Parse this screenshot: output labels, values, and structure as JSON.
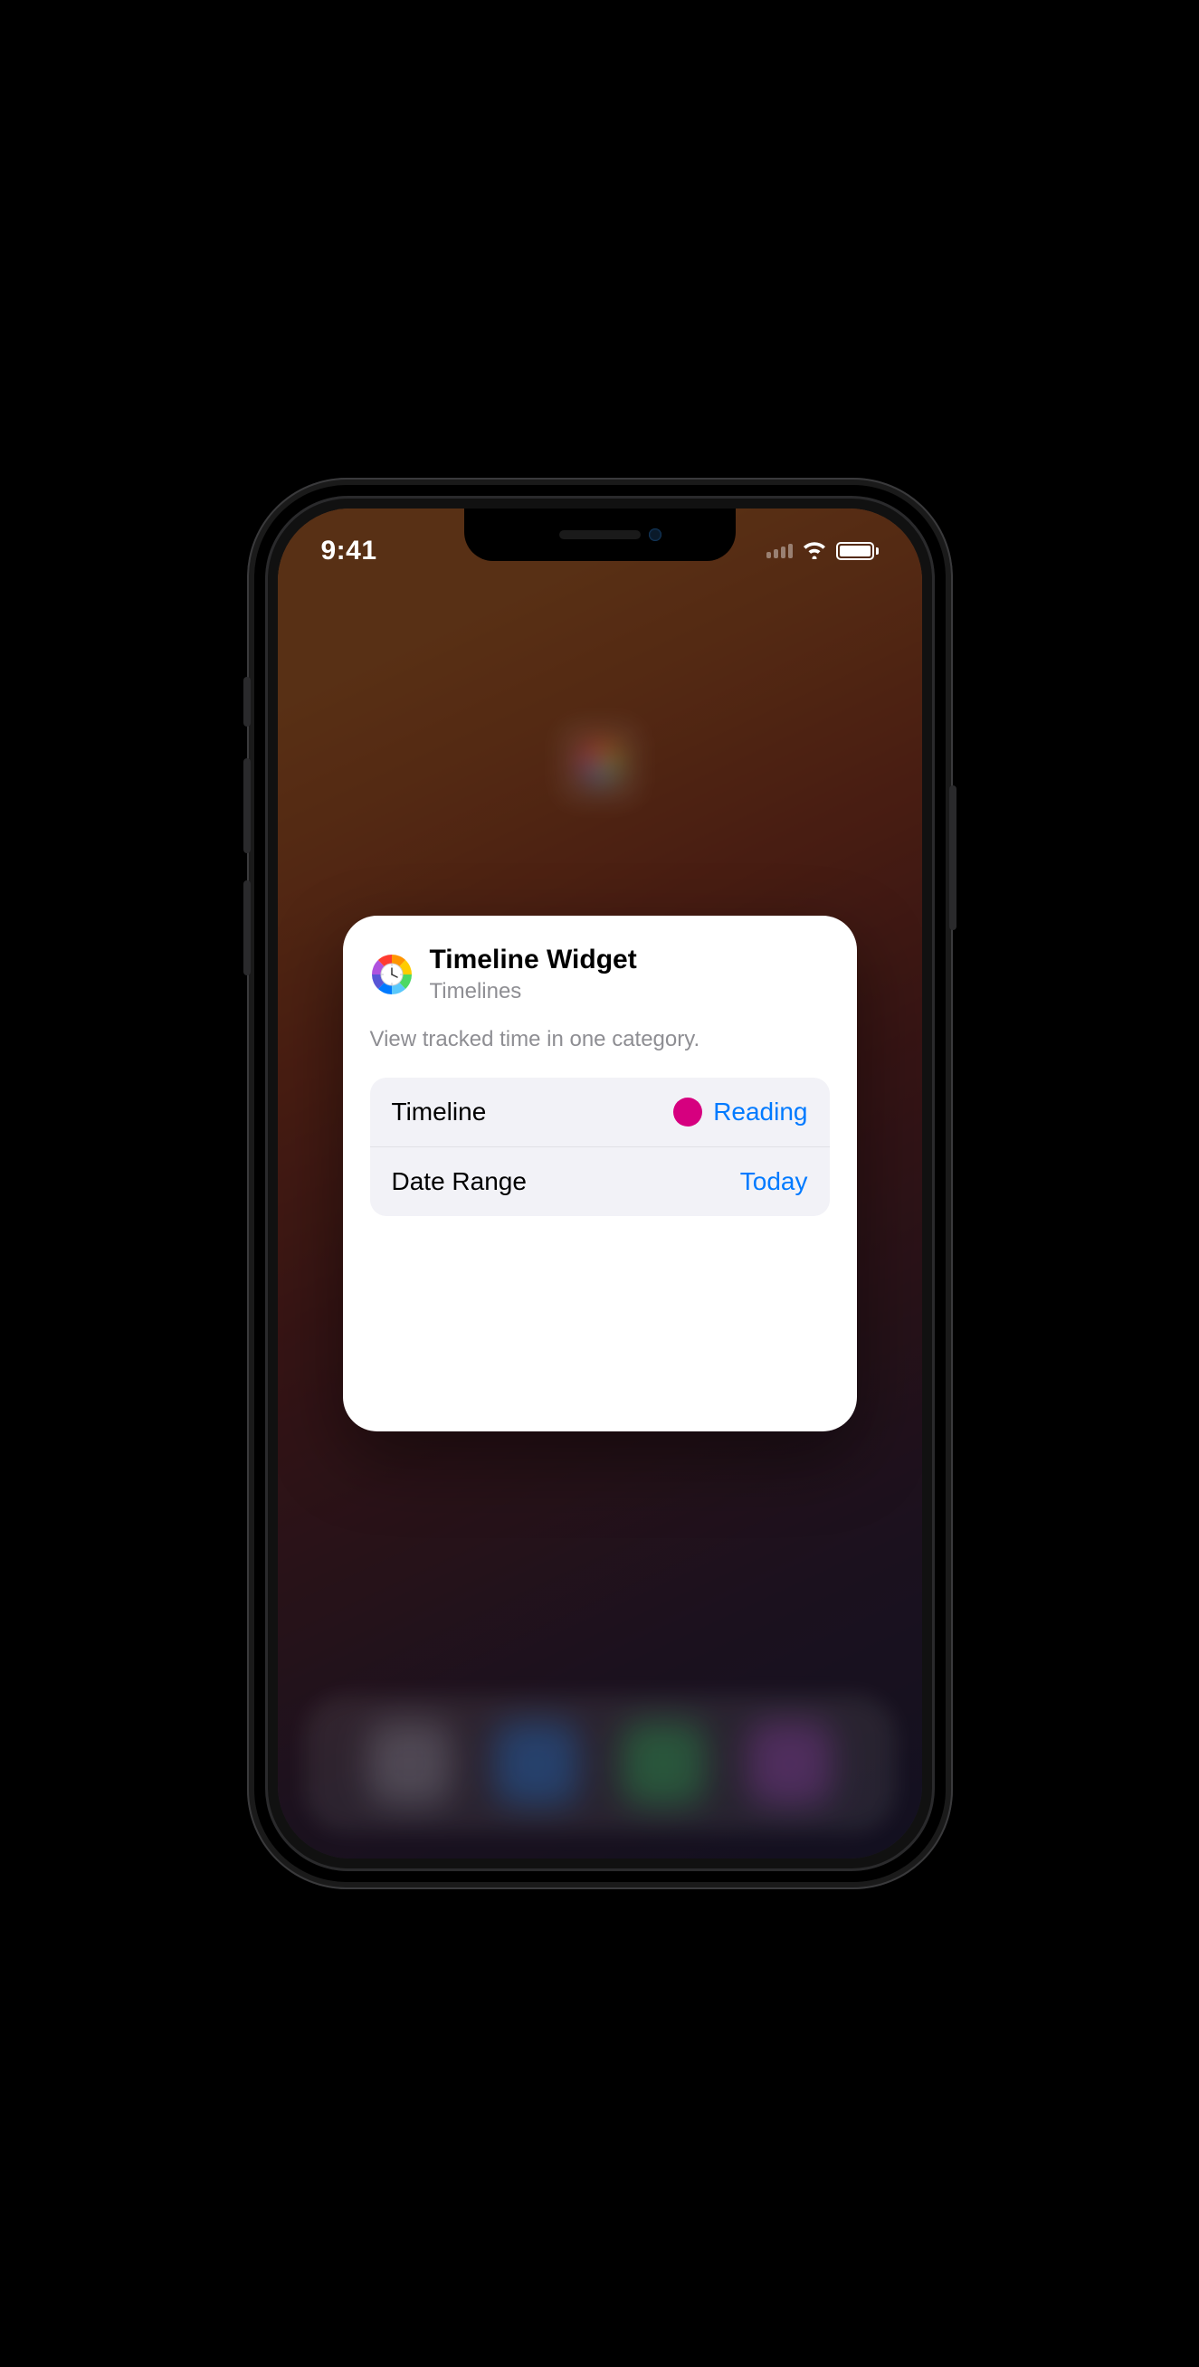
{
  "status": {
    "time": "9:41"
  },
  "widget": {
    "title": "Timeline Widget",
    "subtitle": "Timelines",
    "description": "View tracked time in one category.",
    "settings": [
      {
        "label": "Timeline",
        "value": "Reading",
        "color": "#d6007f"
      },
      {
        "label": "Date Range",
        "value": "Today"
      }
    ]
  }
}
